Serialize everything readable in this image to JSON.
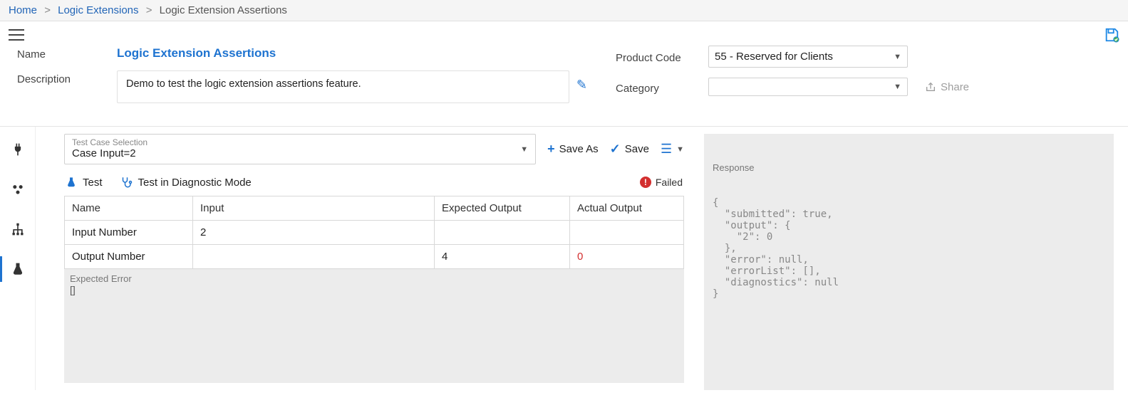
{
  "breadcrumb": {
    "home": "Home",
    "logic_ext": "Logic Extensions",
    "current": "Logic Extension Assertions"
  },
  "header": {
    "name_label": "Name",
    "name_value": "Logic Extension Assertions",
    "desc_label": "Description",
    "desc_value": "Demo to test the logic extension assertions feature.",
    "product_code_label": "Product Code",
    "product_code_value": "55 - Reserved for Clients",
    "category_label": "Category",
    "category_value": "",
    "share_label": "Share"
  },
  "test_toolbar": {
    "tc_label": "Test Case Selection",
    "tc_value": "Case Input=2",
    "save_as": "Save As",
    "save": "Save"
  },
  "test_actions": {
    "test": "Test",
    "diag": "Test in Diagnostic Mode",
    "failed": "Failed"
  },
  "table": {
    "cols": {
      "name": "Name",
      "input": "Input",
      "expected": "Expected Output",
      "actual": "Actual Output"
    },
    "rows": [
      {
        "name": "Input Number",
        "input": "2",
        "expected": "",
        "actual": ""
      },
      {
        "name": "Output Number",
        "input": "",
        "expected": "4",
        "actual": "0",
        "actual_red": true
      }
    ]
  },
  "expected_error": {
    "label": "Expected Error",
    "value": "[]"
  },
  "response": {
    "label": "Response",
    "body": "{\n  \"submitted\": true,\n  \"output\": {\n    \"2\": 0\n  },\n  \"error\": null,\n  \"errorList\": [],\n  \"diagnostics\": null\n}"
  }
}
